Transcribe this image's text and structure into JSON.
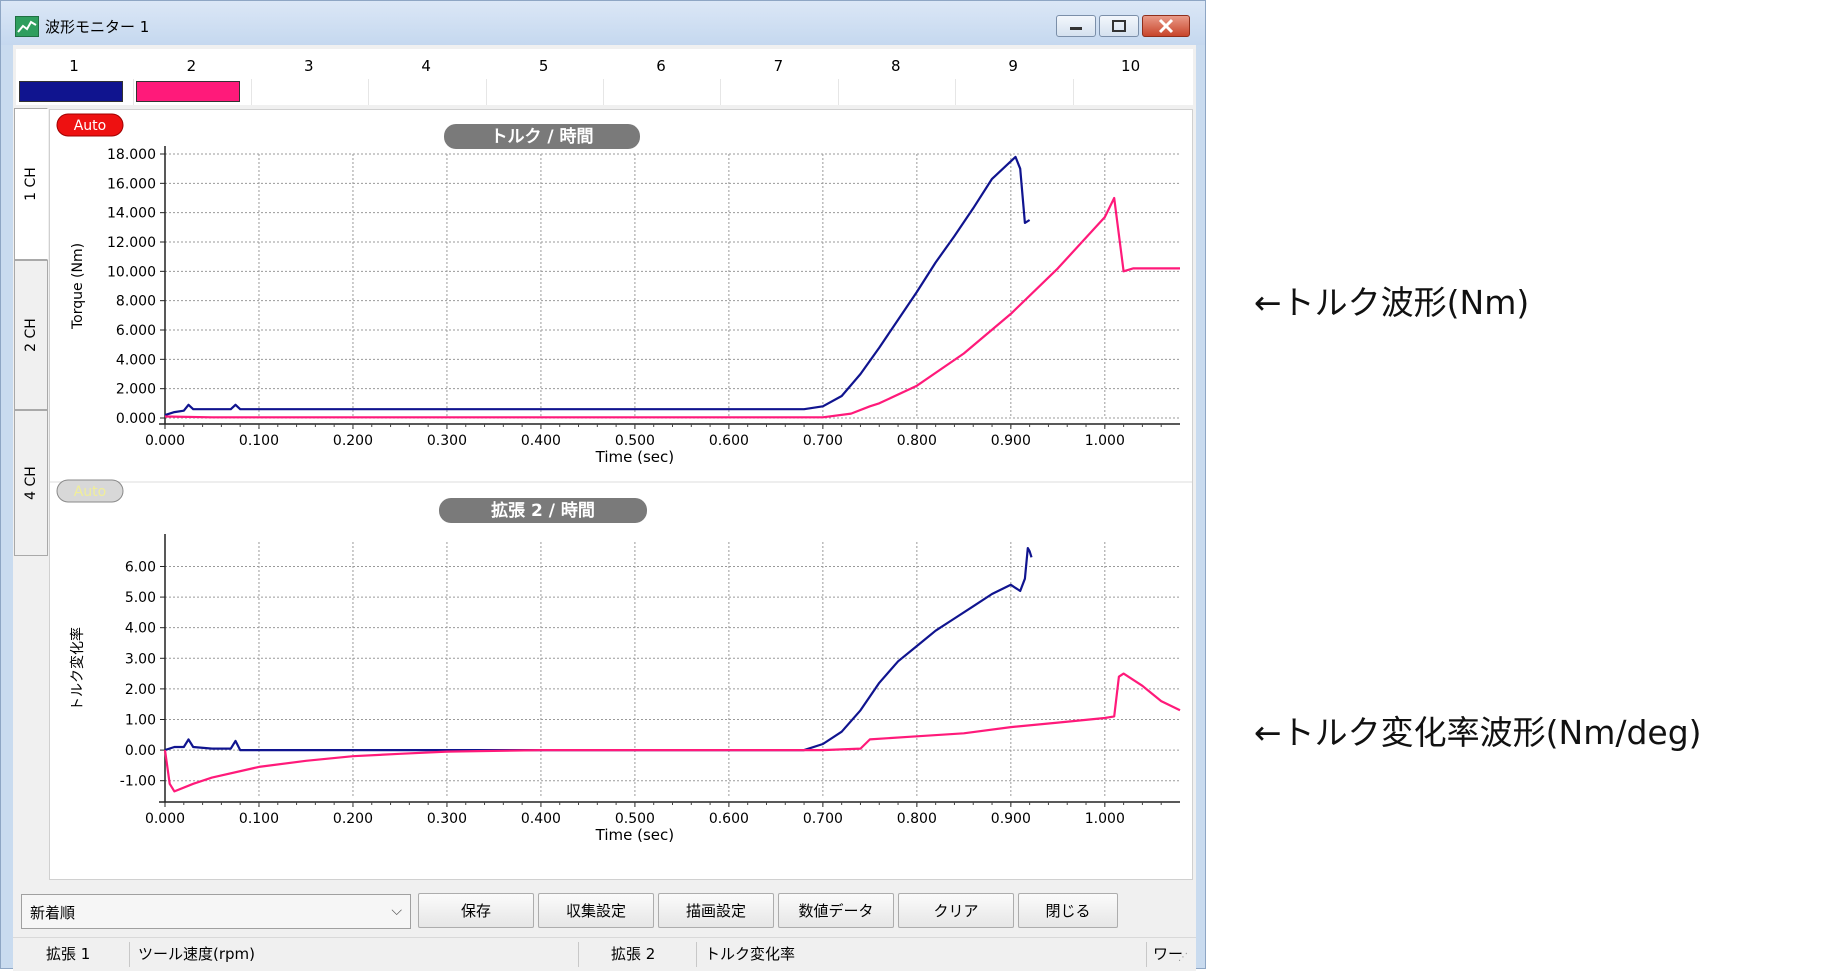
{
  "window": {
    "title": "波形モニター 1",
    "buttons": [
      "minimize",
      "maximize",
      "close"
    ]
  },
  "channels": [
    {
      "label": "1",
      "color": "#10148f"
    },
    {
      "label": "2",
      "color": "#ff1a7a"
    },
    {
      "label": "3",
      "color": ""
    },
    {
      "label": "4",
      "color": ""
    },
    {
      "label": "5",
      "color": ""
    },
    {
      "label": "6",
      "color": ""
    },
    {
      "label": "7",
      "color": ""
    },
    {
      "label": "8",
      "color": ""
    },
    {
      "label": "9",
      "color": ""
    },
    {
      "label": "10",
      "color": ""
    }
  ],
  "side_tabs": [
    "1 CH",
    "2 CH",
    "4 CH"
  ],
  "charts": [
    {
      "auto_badge": "Auto",
      "auto_active": true,
      "title": "トルク / 時間",
      "ylabel": "Torque (Nm)",
      "xlabel": "Time (sec)",
      "yticks": [
        "18.000",
        "16.000",
        "14.000",
        "12.000",
        "10.000",
        "8.000",
        "6.000",
        "4.000",
        "2.000",
        "0.000"
      ],
      "xticks": [
        "0.000",
        "0.100",
        "0.200",
        "0.300",
        "0.400",
        "0.500",
        "0.600",
        "0.700",
        "0.800",
        "0.900",
        "1.000"
      ]
    },
    {
      "auto_badge": "Auto",
      "auto_active": false,
      "title": "拡張 2 / 時間",
      "ylabel": "トルク変化率",
      "xlabel": "Time (sec)",
      "yticks": [
        "6.00",
        "5.00",
        "4.00",
        "3.00",
        "2.00",
        "1.00",
        "0.00",
        "-1.00"
      ],
      "xticks": [
        "0.000",
        "0.100",
        "0.200",
        "0.300",
        "0.400",
        "0.500",
        "0.600",
        "0.700",
        "0.800",
        "0.900",
        "1.000"
      ]
    }
  ],
  "chart_data": [
    {
      "type": "line",
      "title": "トルク / 時間",
      "xlabel": "Time (sec)",
      "ylabel": "Torque (Nm)",
      "xlim": [
        0,
        1.08
      ],
      "ylim": [
        0,
        18
      ],
      "grid": true,
      "series": [
        {
          "color": "#10148f",
          "x": [
            0.0,
            0.01,
            0.02,
            0.025,
            0.03,
            0.07,
            0.075,
            0.08,
            0.2,
            0.3,
            0.4,
            0.5,
            0.6,
            0.68,
            0.7,
            0.72,
            0.74,
            0.76,
            0.78,
            0.8,
            0.82,
            0.84,
            0.86,
            0.88,
            0.9,
            0.905,
            0.91,
            0.915,
            0.92
          ],
          "y": [
            0.2,
            0.4,
            0.5,
            0.9,
            0.6,
            0.6,
            0.9,
            0.6,
            0.6,
            0.6,
            0.6,
            0.6,
            0.6,
            0.6,
            0.8,
            1.5,
            3.0,
            4.8,
            6.7,
            8.6,
            10.6,
            12.4,
            14.3,
            16.3,
            17.5,
            17.8,
            17.0,
            13.3,
            13.5
          ]
        },
        {
          "color": "#ff1a7a",
          "x": [
            0.0,
            0.05,
            0.1,
            0.2,
            0.3,
            0.4,
            0.5,
            0.6,
            0.7,
            0.73,
            0.75,
            0.76,
            0.8,
            0.85,
            0.9,
            0.95,
            1.0,
            1.01,
            1.013,
            1.02,
            1.03,
            1.04,
            1.08
          ],
          "y": [
            0.1,
            0.05,
            0.05,
            0.05,
            0.05,
            0.05,
            0.05,
            0.05,
            0.05,
            0.3,
            0.8,
            1.0,
            2.2,
            4.4,
            7.1,
            10.2,
            13.7,
            15.0,
            13.5,
            10.0,
            10.2,
            10.2,
            10.2
          ]
        }
      ]
    },
    {
      "type": "line",
      "title": "拡張 2 / 時間",
      "xlabel": "Time (sec)",
      "ylabel": "トルク変化率",
      "xlim": [
        0,
        1.08
      ],
      "ylim": [
        -1.5,
        6.8
      ],
      "grid": true,
      "series": [
        {
          "color": "#10148f",
          "x": [
            0.0,
            0.01,
            0.02,
            0.025,
            0.03,
            0.05,
            0.07,
            0.075,
            0.08,
            0.2,
            0.3,
            0.4,
            0.5,
            0.6,
            0.68,
            0.7,
            0.72,
            0.74,
            0.76,
            0.78,
            0.8,
            0.82,
            0.84,
            0.86,
            0.88,
            0.9,
            0.91,
            0.915,
            0.918,
            0.92,
            0.922
          ],
          "y": [
            0.0,
            0.1,
            0.1,
            0.35,
            0.1,
            0.05,
            0.05,
            0.3,
            0.0,
            0.0,
            0.0,
            0.0,
            0.0,
            0.0,
            0.0,
            0.2,
            0.6,
            1.3,
            2.2,
            2.9,
            3.4,
            3.9,
            4.3,
            4.7,
            5.1,
            5.4,
            5.2,
            5.6,
            6.6,
            6.5,
            6.3
          ]
        },
        {
          "color": "#ff1a7a",
          "x": [
            0.0,
            0.005,
            0.01,
            0.03,
            0.05,
            0.1,
            0.15,
            0.2,
            0.25,
            0.3,
            0.4,
            0.5,
            0.6,
            0.7,
            0.74,
            0.75,
            0.8,
            0.85,
            0.9,
            0.95,
            1.0,
            1.01,
            1.015,
            1.02,
            1.03,
            1.04,
            1.06,
            1.08
          ],
          "y": [
            0.0,
            -1.1,
            -1.35,
            -1.1,
            -0.9,
            -0.55,
            -0.35,
            -0.2,
            -0.12,
            -0.05,
            0.0,
            0.0,
            0.0,
            0.0,
            0.05,
            0.35,
            0.45,
            0.55,
            0.75,
            0.9,
            1.05,
            1.1,
            2.4,
            2.5,
            2.3,
            2.1,
            1.6,
            1.3
          ]
        }
      ]
    }
  ],
  "bottom": {
    "select_value": "新着順",
    "buttons": [
      "保存",
      "収集設定",
      "描画設定",
      "数値データ",
      "クリア",
      "閉じる"
    ]
  },
  "status": {
    "ext1_label": "拡張 1",
    "ext1_value": "ツール速度(rpm)",
    "ext2_label": "拡張 2",
    "ext2_value": "トルク変化率",
    "right": "ワー"
  },
  "annotations": {
    "torque": "←トルク波形(Nm)",
    "rate": "←トルク変化率波形(Nm/deg)"
  }
}
